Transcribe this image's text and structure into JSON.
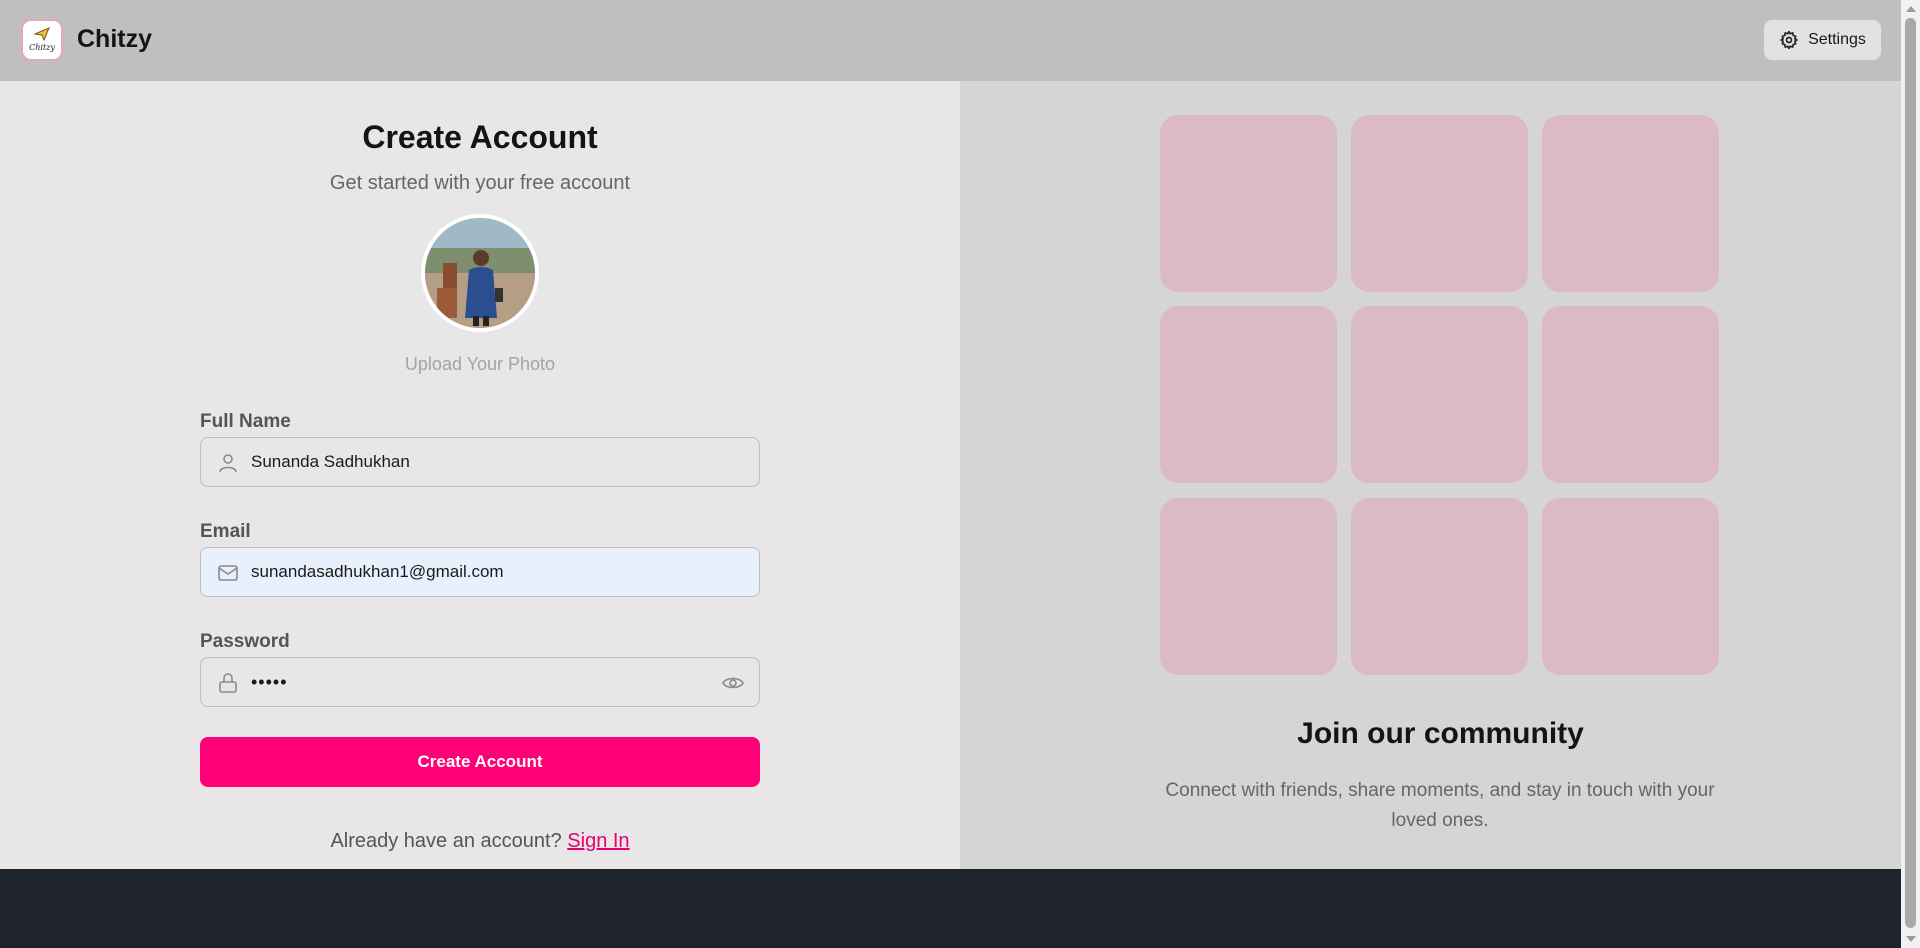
{
  "header": {
    "brand": "Chitzy",
    "logo_text": "Chitzy",
    "settings_label": "Settings"
  },
  "form": {
    "title": "Create Account",
    "subtitle": "Get started with your free account",
    "upload_label": "Upload Your Photo",
    "full_name_label": "Full Name",
    "full_name_value": "Sunanda Sadhukhan",
    "email_label": "Email",
    "email_value": "sunandasadhukhan1@gmail.com",
    "password_label": "Password",
    "password_value": "•••••",
    "submit_label": "Create Account",
    "signin_prompt": "Already have an account?",
    "signin_link": "Sign In"
  },
  "community": {
    "title": "Join our community",
    "text": "Connect with friends, share moments, and stay in touch with your loved ones.",
    "tile_color": "#dbbac6"
  },
  "colors": {
    "accent": "#ff0077",
    "link": "#e6006e"
  },
  "icons": {
    "settings": "gear-icon",
    "name": "user-icon",
    "email": "mail-icon",
    "password": "lock-icon",
    "visibility": "eye-icon"
  }
}
